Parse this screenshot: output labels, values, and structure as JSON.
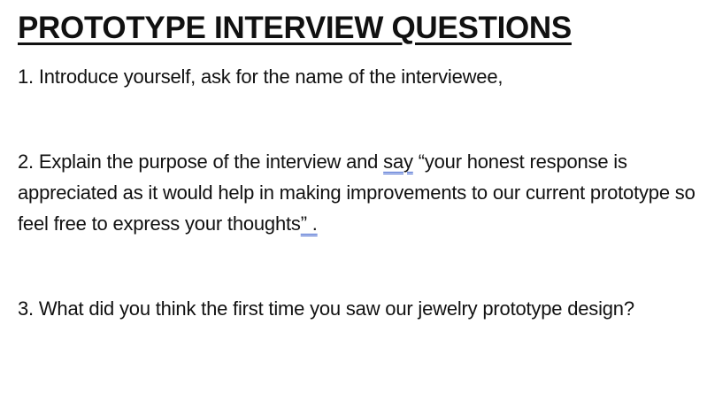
{
  "document": {
    "title": "PROTOTYPE INTERVIEW QUESTIONS",
    "q1": "1. Introduce yourself, ask for the name of the interviewee,",
    "q2": {
      "part1": "2. Explain the purpose of the interview and ",
      "flagged_word": "say",
      "part2": " “your honest response is appreciated as it would help in making improvements to our current prototype so feel free to express your thoughts",
      "flagged_tail": "” .",
      "flag_color": "#3a5fcd"
    },
    "q3": "3. What did you think the first time you saw our jewelry prototype design?"
  }
}
